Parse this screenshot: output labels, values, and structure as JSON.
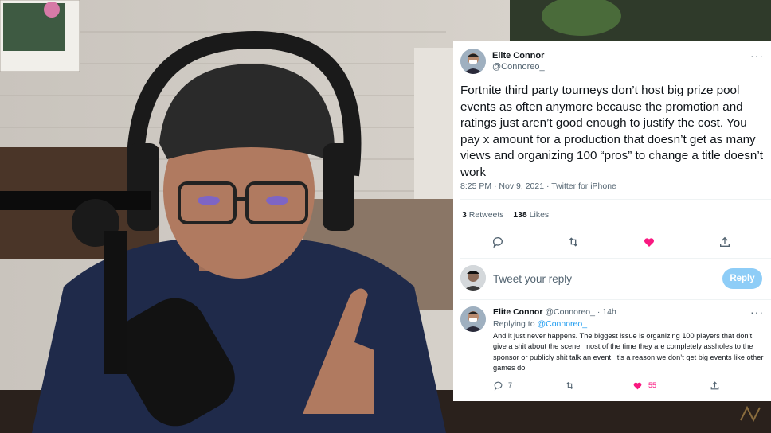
{
  "tweet": {
    "author_name": "Elite Connor",
    "author_handle": "@Connoreo_",
    "text": "Fortnite third party tourneys don’t host big prize pool events as often anymore because the promotion and ratings just aren’t good enough to justify the cost. You pay x amount for a production that doesn’t get as many views and organizing 100 “pros” to change a title doesn’t work",
    "meta": "8:25 PM · Nov 9, 2021 · Twitter for iPhone",
    "retweets_count": "3",
    "retweets_label": "Retweets",
    "likes_count": "138",
    "likes_label": "Likes",
    "more_label": "···"
  },
  "compose": {
    "placeholder": "Tweet your reply",
    "button_label": "Reply"
  },
  "reply": {
    "author_name": "Elite Connor",
    "author_handle": "@Connoreo_",
    "time": "· 14h",
    "replying_to_label": "Replying to",
    "replying_to_handle": "@Connoreo_",
    "text": "And it just never happens. The biggest issue is organizing 100 players that don’t give a shit about the scene, most of the time they are completely assholes to the sponsor or publicly shit talk an event. It’s a reason we don’t get big events like other games do",
    "reply_count": "7",
    "like_count": "55",
    "more_label": "···"
  },
  "colors": {
    "like_pink": "#f91880",
    "link_blue": "#1d9bf0",
    "reply_button": "#8ecdf7"
  }
}
